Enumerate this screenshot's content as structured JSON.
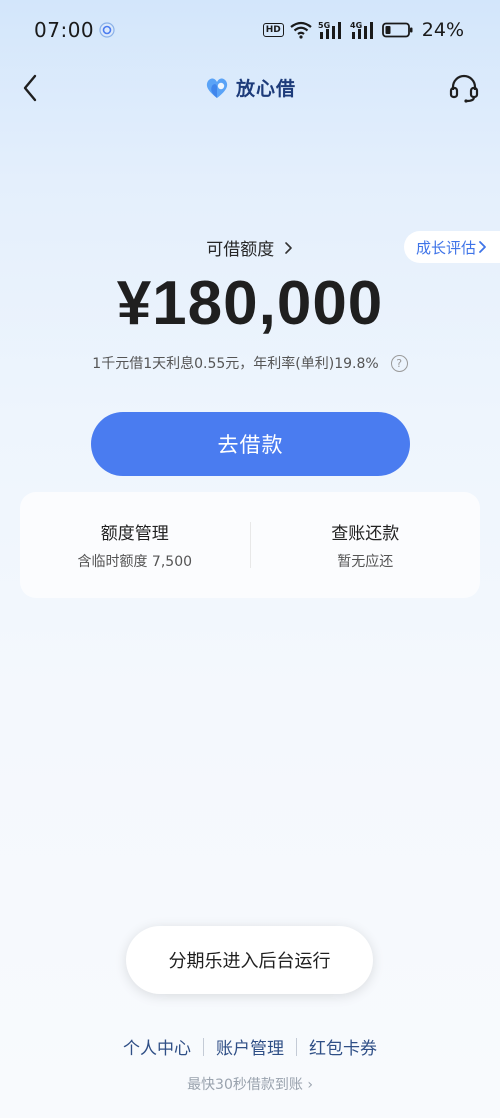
{
  "status_bar": {
    "time": "07:00",
    "hd_label": "HD",
    "network_5g": "5G",
    "network_4g": "4G",
    "battery_percent": "24%",
    "battery_level": 0.24
  },
  "header": {
    "back_icon": "chevron-left-icon",
    "brand_name": "放心借",
    "support_icon": "headset-icon"
  },
  "growth_pill": {
    "label": "成长评估",
    "icon": "chevron-right-icon"
  },
  "credit": {
    "label": "可借额度",
    "amount": "¥180,000",
    "rate_text": "1千元借1天利息0.55元，年利率(单利)19.8%",
    "help_icon_text": "?"
  },
  "borrow_button": {
    "label": "去借款"
  },
  "quick_card": {
    "left": {
      "title": "额度管理",
      "subtitle": "含临时额度 7,500"
    },
    "right": {
      "title": "查账还款",
      "subtitle": "暂无应还"
    }
  },
  "toast": {
    "text": "分期乐进入后台运行"
  },
  "bottom_links": [
    "个人中心",
    "账户管理",
    "红包卡券"
  ],
  "footer_note": "最快30秒借款到账 ›",
  "colors": {
    "accent": "#4a7cf0",
    "link": "#2f4f86",
    "growth_text": "#3f74e8"
  }
}
